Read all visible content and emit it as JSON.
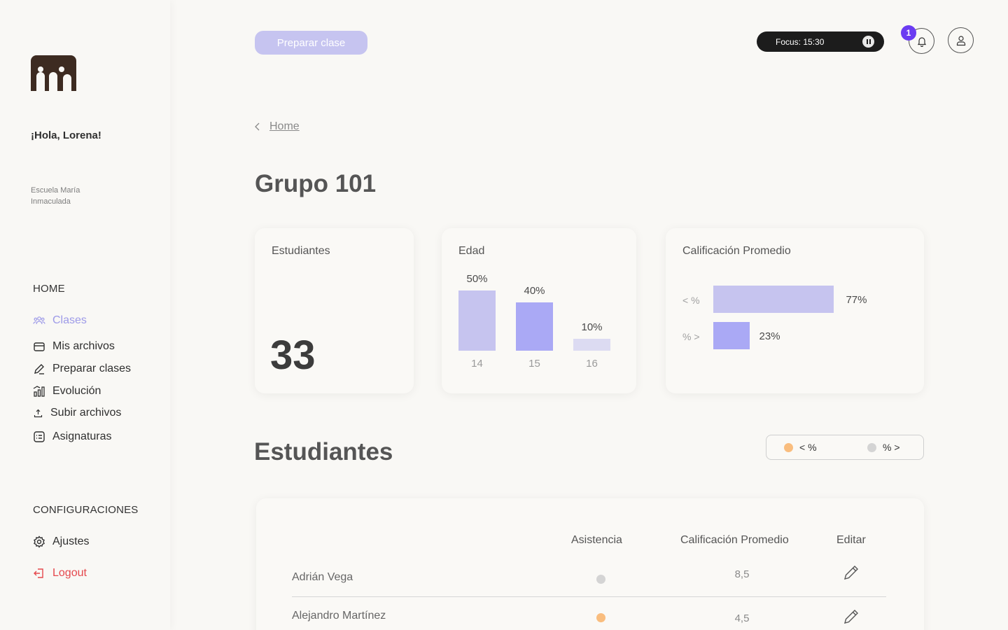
{
  "sidebar": {
    "greeting": "¡Hola, Lorena!",
    "school": "Escuela María Inmaculada",
    "home_label": "HOME",
    "settings_label": "CONFIGURACIONES",
    "items": [
      {
        "label": "Clases",
        "icon": "users-icon",
        "active": true
      },
      {
        "label": "Mis archivos",
        "icon": "folder-icon"
      },
      {
        "label": "Preparar clases",
        "icon": "pencil-icon"
      },
      {
        "label": "Evolución",
        "icon": "bar-chart-icon"
      },
      {
        "label": "Subir archivos",
        "icon": "upload-icon"
      },
      {
        "label": "Asignaturas",
        "icon": "list-icon"
      }
    ],
    "settings": {
      "label": "Ajustes",
      "icon": "gear-icon"
    },
    "logout": {
      "label": "Logout",
      "icon": "logout-icon"
    }
  },
  "topbar": {
    "prepare_button": "Preparar clase",
    "focus": "Focus: 15:30",
    "notifications_count": "1"
  },
  "breadcrumb": {
    "label": "Home"
  },
  "page_title": "Grupo 101",
  "cards": {
    "students": {
      "title": "Estudiantes",
      "value": "33"
    },
    "age": {
      "title": "Edad",
      "bars": [
        {
          "category": "14",
          "label": "50%",
          "value": 50,
          "color": "#c6c4ef"
        },
        {
          "category": "15",
          "label": "40%",
          "value": 40,
          "color": "#aaa9f5"
        },
        {
          "category": "16",
          "label": "10%",
          "value": 10,
          "color": "#dcdbf2"
        }
      ]
    },
    "grade": {
      "title": "Calificación Promedio",
      "bars": [
        {
          "category": "< %",
          "label": "77%",
          "value": 77,
          "color": "#c6c4ef"
        },
        {
          "category": "% >",
          "label": "23%",
          "value": 23,
          "color": "#aaa9f5"
        }
      ]
    }
  },
  "students_section": {
    "title": "Estudiantes",
    "legend": [
      {
        "label": "<  %",
        "color": "#f9bd7e"
      },
      {
        "label": "%  >",
        "color": "#d4d4d4"
      }
    ],
    "columns": {
      "attendance": "Asistencia",
      "grade": "Calificación Promedio",
      "edit": "Editar"
    },
    "rows": [
      {
        "name": "Adrián Vega",
        "attendance_color": "#d4d4d4",
        "grade": "8,5"
      },
      {
        "name": "Alejandro Martínez",
        "attendance_color": "#f9bd7e",
        "grade": "4,5"
      }
    ]
  }
}
